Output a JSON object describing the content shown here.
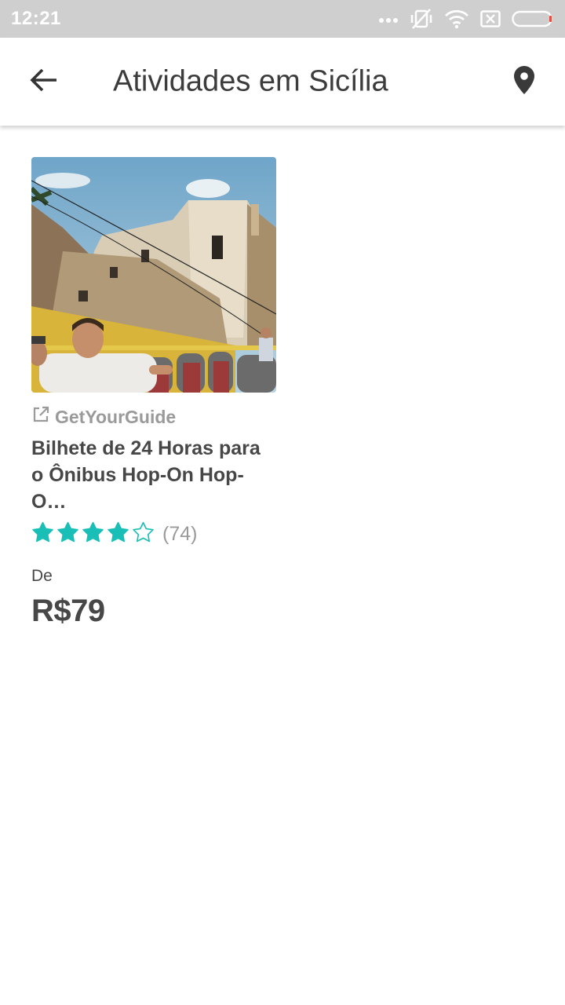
{
  "status_bar": {
    "time": "12:21",
    "icons": [
      "more-dots-icon",
      "vibrate-off-icon",
      "wifi-icon",
      "sim-off-icon",
      "battery-icon"
    ]
  },
  "app_bar": {
    "back_icon": "arrow-back-icon",
    "title": "Atividades em Sicília",
    "location_icon": "map-pin-icon"
  },
  "card": {
    "image_description_icon": "photo",
    "provider": "GetYourGuide",
    "provider_icon": "external-link-icon",
    "title_line1": "Bilhete de 24 Horas para",
    "title_line2": "o Ônibus Hop-On Hop-O…",
    "rating": 4,
    "rating_max": 5,
    "reviews": "(74)",
    "price_prefix": "De",
    "price": "R$79"
  },
  "colors": {
    "status_bar": "#cfcfcf",
    "star": "#19bfb6",
    "text_dark": "#474747",
    "text_muted": "#9a9a9a"
  }
}
